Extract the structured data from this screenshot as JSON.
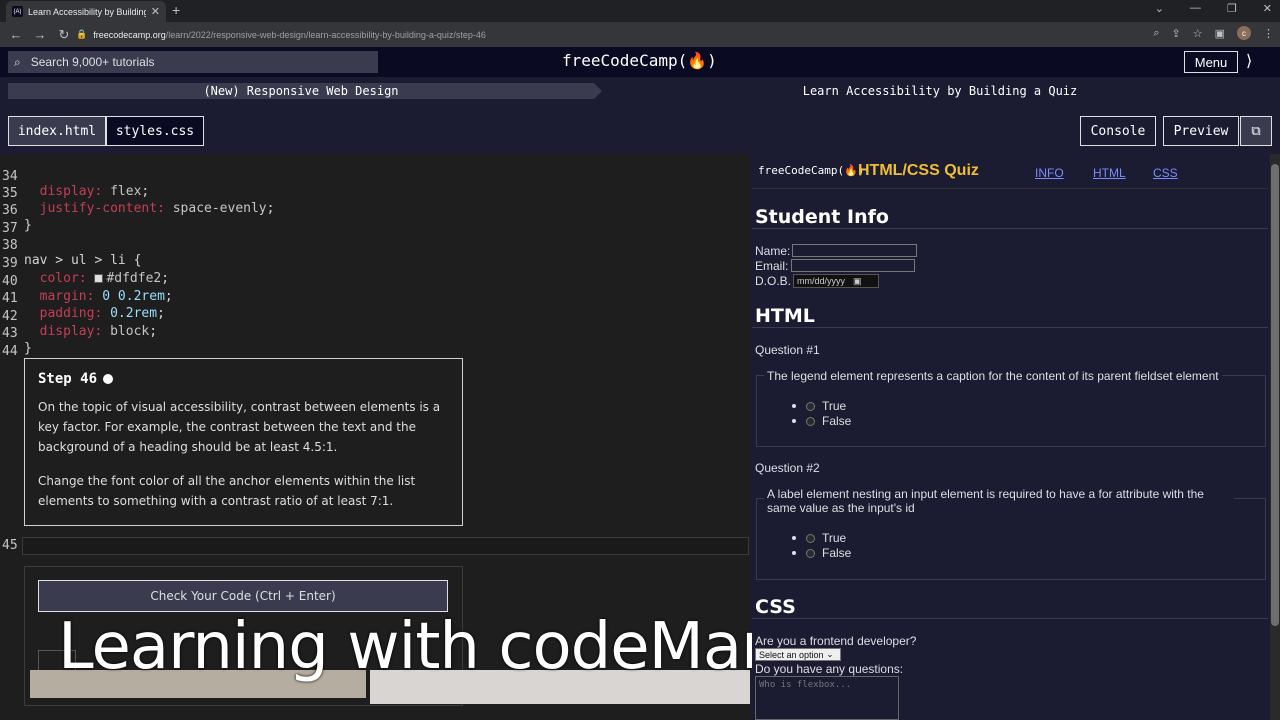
{
  "browser": {
    "tab_title": "Learn Accessibility by Building a Q",
    "tab_favicon": "(A)",
    "new_tab": "+",
    "url_host": "freecodecamp.org",
    "url_path": "/learn/2022/responsive-web-design/learn-accessibility-by-building-a-quiz/step-46",
    "avatar": "c"
  },
  "nav": {
    "search_placeholder": "Search 9,000+ tutorials",
    "brand": "freeCodeCamp(🔥)",
    "menu": "Menu"
  },
  "breadcrumb": {
    "superblock": "(New) Responsive Web Design",
    "block": "Learn Accessibility by Building a Quiz"
  },
  "editor_tabs": {
    "files": [
      "index.html",
      "styles.css"
    ],
    "console": "Console",
    "preview": "Preview"
  },
  "code": {
    "l34": {
      "n": "34",
      "prop": "display",
      "val": "flex"
    },
    "l35": {
      "n": "35",
      "prop": "justify-content",
      "val": "space-evenly"
    },
    "l36": {
      "n": "36",
      "text": "}"
    },
    "l37": {
      "n": "37",
      "text": ""
    },
    "l38": {
      "n": "38",
      "text": "nav > ul > li {"
    },
    "l39": {
      "n": "39",
      "prop": "color",
      "val": "#dfdfe2"
    },
    "l40": {
      "n": "40",
      "prop": "margin",
      "val": "0 0.2rem"
    },
    "l41": {
      "n": "41",
      "prop": "padding",
      "val": "0.2rem"
    },
    "l42": {
      "n": "42",
      "prop": "display",
      "val": "block"
    },
    "l43": {
      "n": "43",
      "text": "}"
    },
    "l44": {
      "n": "44",
      "text": ""
    },
    "l45": {
      "n": "45",
      "text": ""
    }
  },
  "step": {
    "title": "Step 46",
    "p1": "On the topic of visual accessibility, contrast between elements is a key factor. For example, the contrast between the text and the background of a heading should be at least 4.5:1.",
    "p2": "Change the font color of all the anchor elements within the list elements to something with a contrast ratio of at least 7:1."
  },
  "check_button": "Check Your Code (Ctrl + Enter)",
  "caption": "Learning with codeManS",
  "preview": {
    "logo": "freeCodeCamp(🔥)",
    "title": "HTML/CSS Quiz",
    "links": [
      "INFO",
      "HTML",
      "CSS"
    ],
    "student_heading": "Student Info",
    "name_label": "Name:",
    "email_label": "Email:",
    "dob_label": "D.O.B.",
    "dob_placeholder": "mm/dd/yyyy",
    "html_heading": "HTML",
    "q1_label": "Question #1",
    "q1_legend": "The legend element represents a caption for the content of its parent fieldset element",
    "q2_label": "Question #2",
    "q2_legend": "A label element nesting an input element is required to have a for attribute with the same value as the input's id",
    "opt_true": "True",
    "opt_false": "False",
    "css_heading": "CSS",
    "frontend_label": "Are you a frontend developer?",
    "select_value": "Select an option",
    "questions_label": "Do you have any questions:",
    "textarea_placeholder": "Who is flexbox..."
  },
  "colors": {
    "bg": "#1b1b32",
    "nav": "#0a0a23",
    "accent": "#f1be32",
    "css_property": "#c33f56"
  }
}
